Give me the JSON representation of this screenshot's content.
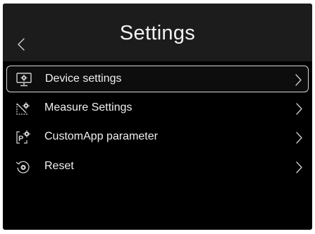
{
  "header": {
    "title": "Settings",
    "back_icon": "chevron-left-icon"
  },
  "menu": {
    "items": [
      {
        "label": "Device settings",
        "icon": "monitor-gear-icon",
        "selected": true
      },
      {
        "label": "Measure Settings",
        "icon": "measure-gear-icon",
        "selected": false
      },
      {
        "label": "CustomApp parameter",
        "icon": "parameter-gear-icon",
        "selected": false
      },
      {
        "label": "Reset",
        "icon": "reset-icon",
        "selected": false
      }
    ]
  },
  "colors": {
    "background": "#000000",
    "header": "#1c1c1c",
    "text": "#f0f0f0",
    "selected_border": "#d6d6d6",
    "icon": "#cfcfcf"
  }
}
